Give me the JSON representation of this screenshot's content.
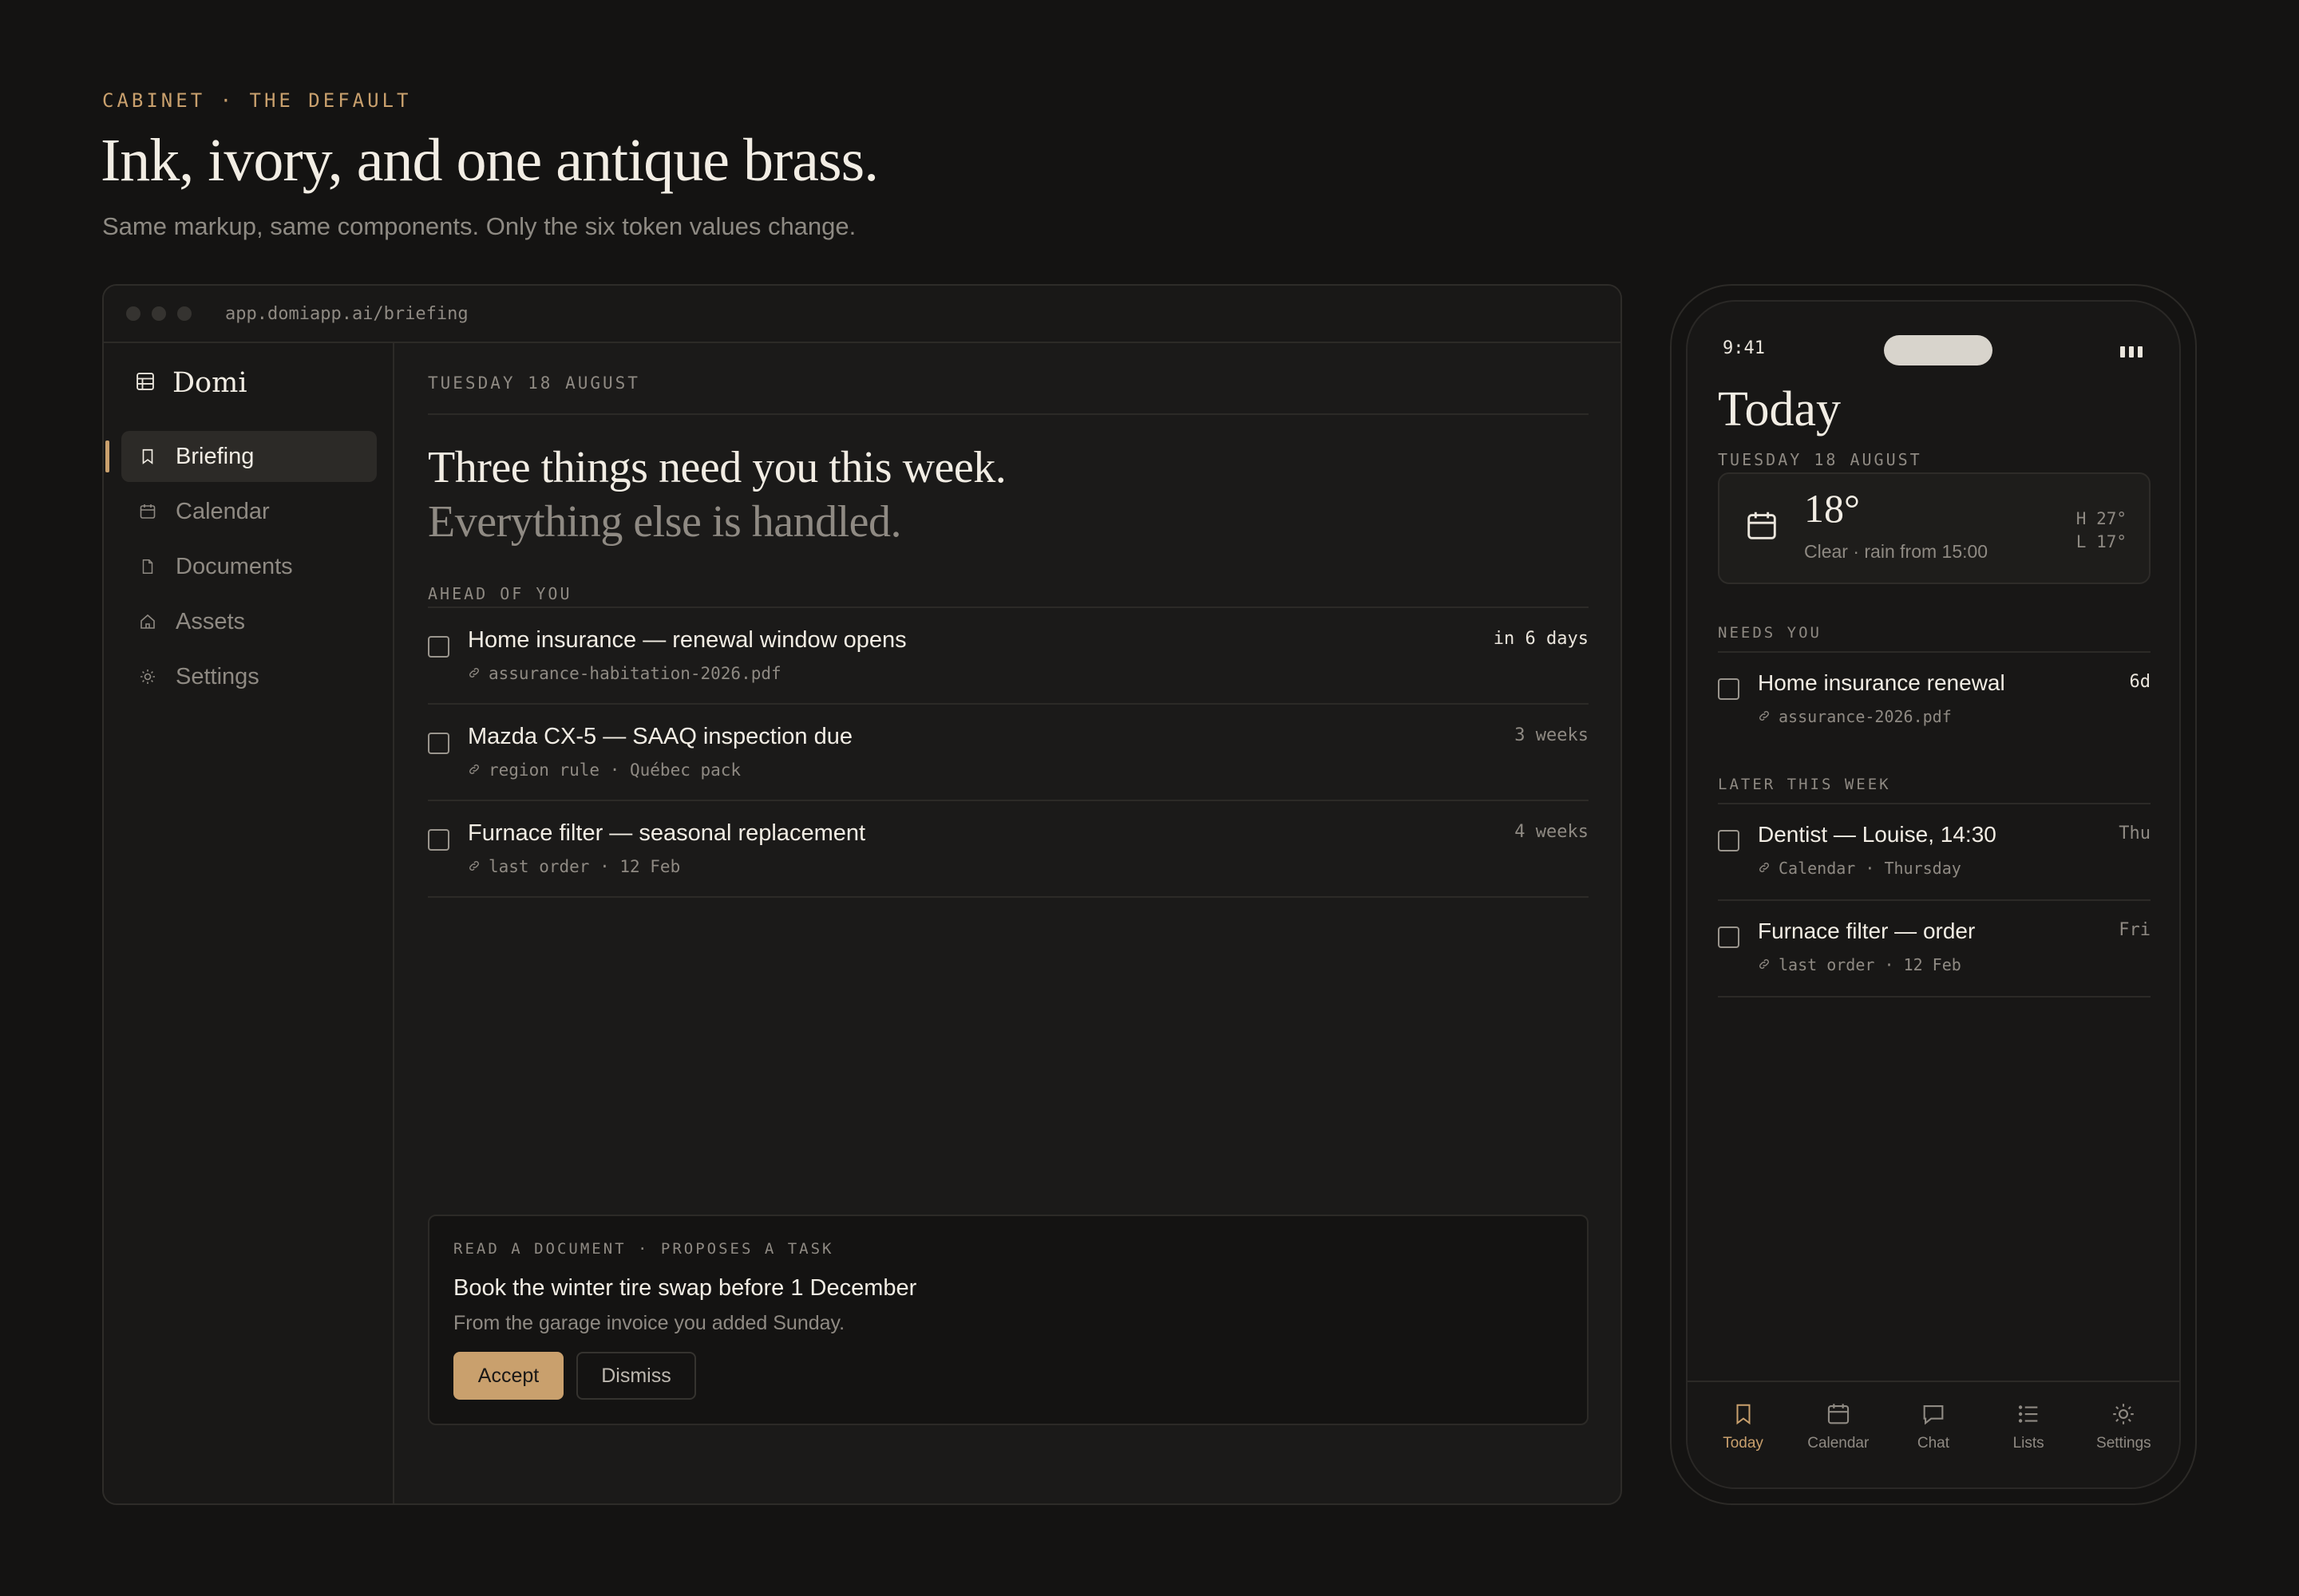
{
  "header": {
    "eyebrow": "CABINET · THE DEFAULT",
    "title": "Ink, ivory, and one antique brass.",
    "subtitle": "Same markup, same components. Only the six token values change."
  },
  "colors": {
    "accent": "#c9a06d",
    "background": "#141312",
    "surface": "#1b1a19",
    "text": "#f2ede4",
    "muted": "#8f8a83"
  },
  "browser": {
    "url": "app.domiapp.ai/briefing",
    "brand": {
      "name": "Domi",
      "icon": "ledger-icon"
    },
    "nav": [
      {
        "label": "Briefing",
        "icon": "bookmark-icon",
        "active": true
      },
      {
        "label": "Calendar",
        "icon": "calendar-icon"
      },
      {
        "label": "Documents",
        "icon": "document-icon"
      },
      {
        "label": "Assets",
        "icon": "house-icon"
      },
      {
        "label": "Settings",
        "icon": "gear-icon"
      }
    ],
    "main": {
      "date": "TUESDAY 18 AUGUST",
      "headline_1": "Three things need you this week.",
      "headline_2": "Everything else is handled.",
      "section_label": "AHEAD OF YOU",
      "tasks": [
        {
          "title": "Home insurance — renewal window opens",
          "meta": "assurance-habitation-2026.pdf",
          "when": "in 6 days"
        },
        {
          "title": "Mazda CX-5 — SAAQ inspection due",
          "meta": "region rule · Québec pack",
          "when": "3 weeks"
        },
        {
          "title": "Furnace filter — seasonal replacement",
          "meta": "last order · 12 Feb",
          "when": "4 weeks"
        }
      ],
      "proposal": {
        "eyebrow": "READ A DOCUMENT · PROPOSES A TASK",
        "title": "Book the winter tire swap before 1 December",
        "subtitle": "From the garage invoice you added Sunday.",
        "accept_label": "Accept",
        "dismiss_label": "Dismiss"
      }
    }
  },
  "phone": {
    "time": "9:41",
    "title": "Today",
    "date": "TUESDAY 18 AUGUST",
    "weather": {
      "temp": "18°",
      "desc": "Clear · rain from 15:00",
      "high": "H 27°",
      "low": "L 17°",
      "icon": "calendar-icon"
    },
    "needs_label": "NEEDS YOU",
    "needs": [
      {
        "title": "Home insurance renewal",
        "meta": "assurance-2026.pdf",
        "when": "6d"
      }
    ],
    "later_label": "LATER THIS WEEK",
    "later": [
      {
        "title": "Dentist — Louise, 14:30",
        "meta": "Calendar · Thursday",
        "when": "Thu"
      },
      {
        "title": "Furnace filter — order",
        "meta": "last order · 12 Feb",
        "when": "Fri"
      }
    ],
    "tabs": [
      {
        "label": "Today",
        "icon": "bookmark-icon",
        "active": true
      },
      {
        "label": "Calendar",
        "icon": "calendar-icon"
      },
      {
        "label": "Chat",
        "icon": "chat-icon"
      },
      {
        "label": "Lists",
        "icon": "list-icon"
      },
      {
        "label": "Settings",
        "icon": "gear-icon"
      }
    ]
  }
}
